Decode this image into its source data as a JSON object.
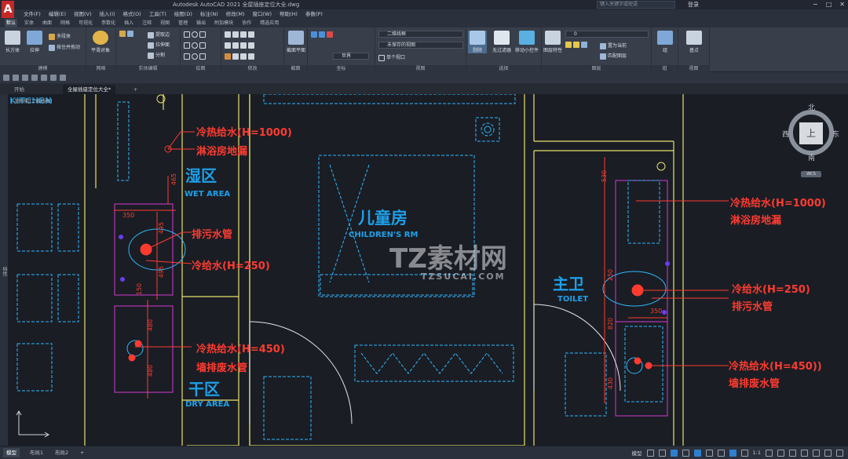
{
  "window": {
    "title": "Autodesk AutoCAD 2021    全屋插座定位大全.dwg",
    "search_placeholder": "键入关键字或短语",
    "login": "登录",
    "controls": [
      "−",
      "□",
      "✕"
    ]
  },
  "menu": [
    "文件(F)",
    "编辑(E)",
    "视图(V)",
    "插入(I)",
    "格式(O)",
    "工具(T)",
    "绘图(D)",
    "标注(N)",
    "修改(M)",
    "窗口(W)",
    "帮助(H)",
    "参数(P)"
  ],
  "ribbon_tabs": [
    "默认",
    "实体",
    "曲面",
    "网格",
    "可视化",
    "参数化",
    "插入",
    "注释",
    "视图",
    "管理",
    "输出",
    "附加模块",
    "协作",
    "精选应用"
  ],
  "ribbon": {
    "panels": [
      "建模",
      "网格",
      "实体编辑",
      "绘图",
      "修改",
      "截面",
      "坐标",
      "视图",
      "选择",
      "图层",
      "组",
      "视图"
    ],
    "buttons": {
      "box": "长方体",
      "extrude": "拉伸",
      "polysolid": "多段体",
      "presspull": "按住并拖动",
      "smooth": "平滑对象",
      "extract_edges": "提取边",
      "extrude_face": "拉伸面",
      "separate": "分割",
      "section_plane": "截面平面",
      "world": "世界",
      "culling": "剔除",
      "no_filter": "无过滤器",
      "move_gizmo": "移动小控件",
      "layer_props": "图层特性",
      "set_current": "置为当前",
      "match_layer": "匹配图层",
      "group": "组",
      "base": "基点"
    },
    "dropdowns": {
      "visual_style": "二维线框",
      "saved_view": "未保存的视图",
      "viewport": "单个视口",
      "layer": "0"
    }
  },
  "file_tabs": [
    "开始",
    "全屋插座定位大全*"
  ],
  "viewport_label": "[-][俯视][二维线框]",
  "left_bar_label": "特性",
  "drawing": {
    "rooms": [
      {
        "zh": "湿区",
        "en": "WET AREA"
      },
      {
        "zh": "儿童房",
        "en": "CHILDREN'S RM"
      },
      {
        "zh": "主卫",
        "en": "TOILET"
      },
      {
        "zh": "干区",
        "en": "DRY AREA"
      }
    ],
    "kitchen_label": "KITCHEN",
    "annotations": [
      "冷热给水(H=1000)",
      "淋浴房地漏",
      "排污水管",
      "冷给水(H=250)",
      "冷热给水(H=450)",
      "墙排废水管",
      "冷热给水(H=1000)",
      "淋浴房地漏",
      "冷给水(H=250)",
      "排污水管",
      "冷热给水(H=450))",
      "墙排废水管"
    ],
    "dimensions": [
      "465",
      "350",
      "495",
      "495",
      "150",
      "480",
      "480",
      "530",
      "250",
      "820",
      "350",
      "430"
    ],
    "watermark": {
      "cn": "TZ素材网",
      "url": "TZSUCAI.COM"
    }
  },
  "viewcube": {
    "north": "北",
    "south": "南",
    "east": "东",
    "west": "西",
    "face": "上",
    "wcs": "WCS"
  },
  "status": {
    "tabs": [
      "模型",
      "布局1",
      "布局2"
    ],
    "model_label": "模型",
    "scale": "1:1"
  },
  "colors": {
    "annotation": "#ff3b30",
    "room_label": "#1ea0e8",
    "wall": "#e8e26a",
    "furniture": "#2fb7ff",
    "partition": "#d23cd2"
  }
}
